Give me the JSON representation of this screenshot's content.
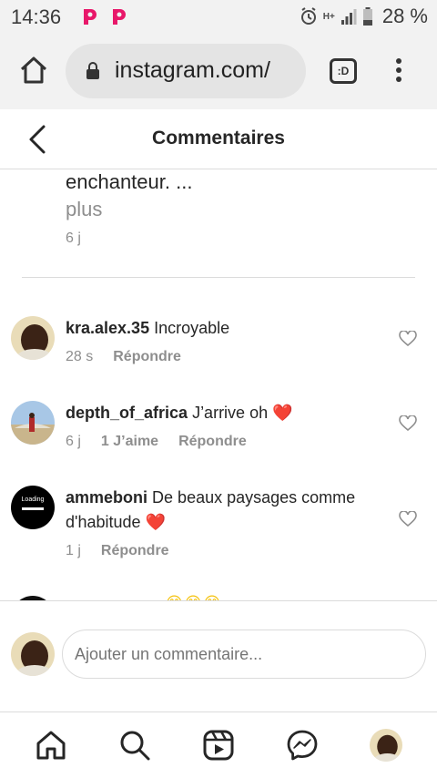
{
  "status": {
    "time": "14:36",
    "network": "H+",
    "battery": "28 %",
    "icons": [
      "pinterest-icon",
      "pinterest-icon",
      "alarm-icon",
      "network-icon",
      "signal-icon",
      "battery-icon"
    ]
  },
  "browser": {
    "url": "instagram.com/",
    "tabs_label": ":D",
    "icons": [
      "home-icon",
      "lock-icon",
      "tabs-icon",
      "more-vertical-icon"
    ]
  },
  "header": {
    "title": "Commentaires",
    "back_icon": "chevron-left-icon"
  },
  "caption": {
    "tail": "enchanteur. ...",
    "more": "plus",
    "time": "6 j"
  },
  "comments": [
    {
      "username": "kra.alex.35",
      "text": "Incroyable",
      "time": "28 s",
      "likes": "",
      "reply": "Répondre"
    },
    {
      "username": "depth_of_africa",
      "text": "J’arrive oh",
      "emoji": "❤️",
      "time": "6 j",
      "likes": "1 J’aime",
      "reply": "Répondre"
    },
    {
      "username": "ammeboni",
      "text": "De beaux paysages comme d'habitude",
      "emoji": "❤️",
      "avatar_text": "Loading",
      "time": "1 j",
      "likes": "",
      "reply": "Répondre"
    }
  ],
  "partial_comment": {
    "emoji": "😊😊😊"
  },
  "compose": {
    "placeholder": "Ajouter un commentaire..."
  },
  "bottom_nav": {
    "icons": [
      "home-icon",
      "search-icon",
      "reels-icon",
      "messenger-icon",
      "profile-avatar"
    ]
  },
  "colors": {
    "text": "#262626",
    "secondary": "#8e8e8e",
    "divider": "#dbdbdb",
    "heart": "#e0162b",
    "browser_bg": "#f2f2f2"
  }
}
